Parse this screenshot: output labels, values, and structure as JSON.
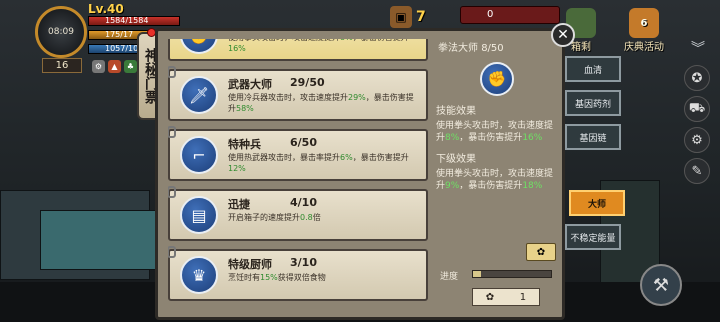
{
  "hud": {
    "level": "Lv.40",
    "clock": "08:09",
    "hp": "1584/1584",
    "energy": "175/17",
    "water": "1057/10",
    "day": "16",
    "top_res_1": "7",
    "top_currency": "0",
    "event_1": "箱剩",
    "event_2_count": "6",
    "event_2": "庆典活动"
  },
  "side_tab": {
    "label": "神秘门票"
  },
  "skills": [
    {
      "name": "",
      "level": "",
      "desc_pre": "使用拳头攻击时，攻击速度提升",
      "p1": "8%",
      "desc_mid": "，暴击伤害提升",
      "p2": "16%",
      "desc_end": "",
      "icon": "fist-icon"
    },
    {
      "name": "武器大师",
      "level": "29/50",
      "desc_pre": "使用冷兵器攻击时，攻击速度提升",
      "p1": "29%",
      "desc_mid": "，暴击伤害提升",
      "p2": "58%",
      "desc_end": "",
      "icon": "knife-icon"
    },
    {
      "name": "特种兵",
      "level": "6/50",
      "desc_pre": "使用热武器攻击时，暴击率提升",
      "p1": "6%",
      "desc_mid": "，暴击伤害提升",
      "p2": "12%",
      "desc_end": "",
      "icon": "rifle-icon"
    },
    {
      "name": "迅捷",
      "level": "4/10",
      "desc_pre": "开启箱子的速度提升",
      "p1": "0.8",
      "desc_mid": "倍",
      "p2": "",
      "desc_end": "",
      "icon": "chest-icon"
    },
    {
      "name": "特级厨师",
      "level": "3/10",
      "desc_pre": "烹饪时有",
      "p1": "15%",
      "desc_mid": "获得双倍食物",
      "p2": "",
      "desc_end": "",
      "icon": "chef-hat-icon"
    }
  ],
  "detail": {
    "title": "拳法大师",
    "level": "8/50",
    "skill_effect_label": "技能效果",
    "skill_effect_pre": "使用拳头攻击时，攻击速度提升",
    "skill_effect_p1": "8%",
    "skill_effect_mid": "，暴击伤害提升",
    "skill_effect_p2": "16%",
    "next_effect_label": "下级效果",
    "next_effect_pre": "使用拳头攻击时，攻击速度提升",
    "next_effect_p1": "9%",
    "next_effect_mid": "，暴击伤害提升",
    "next_effect_p2": "18%",
    "progress_label": "进度",
    "progress_fraction": 0.1,
    "count": "1"
  },
  "categories": [
    {
      "label": "血清",
      "selected": false
    },
    {
      "label": "基因药剂",
      "selected": false
    },
    {
      "label": "基因链",
      "selected": false
    },
    {
      "label": "大师",
      "selected": true
    },
    {
      "label": "不稳定能量",
      "selected": false
    }
  ],
  "colors": {
    "highlight_green": "#2f8a2e",
    "selected_tab": "#e08a20",
    "hp_bar": "#c8322a"
  }
}
